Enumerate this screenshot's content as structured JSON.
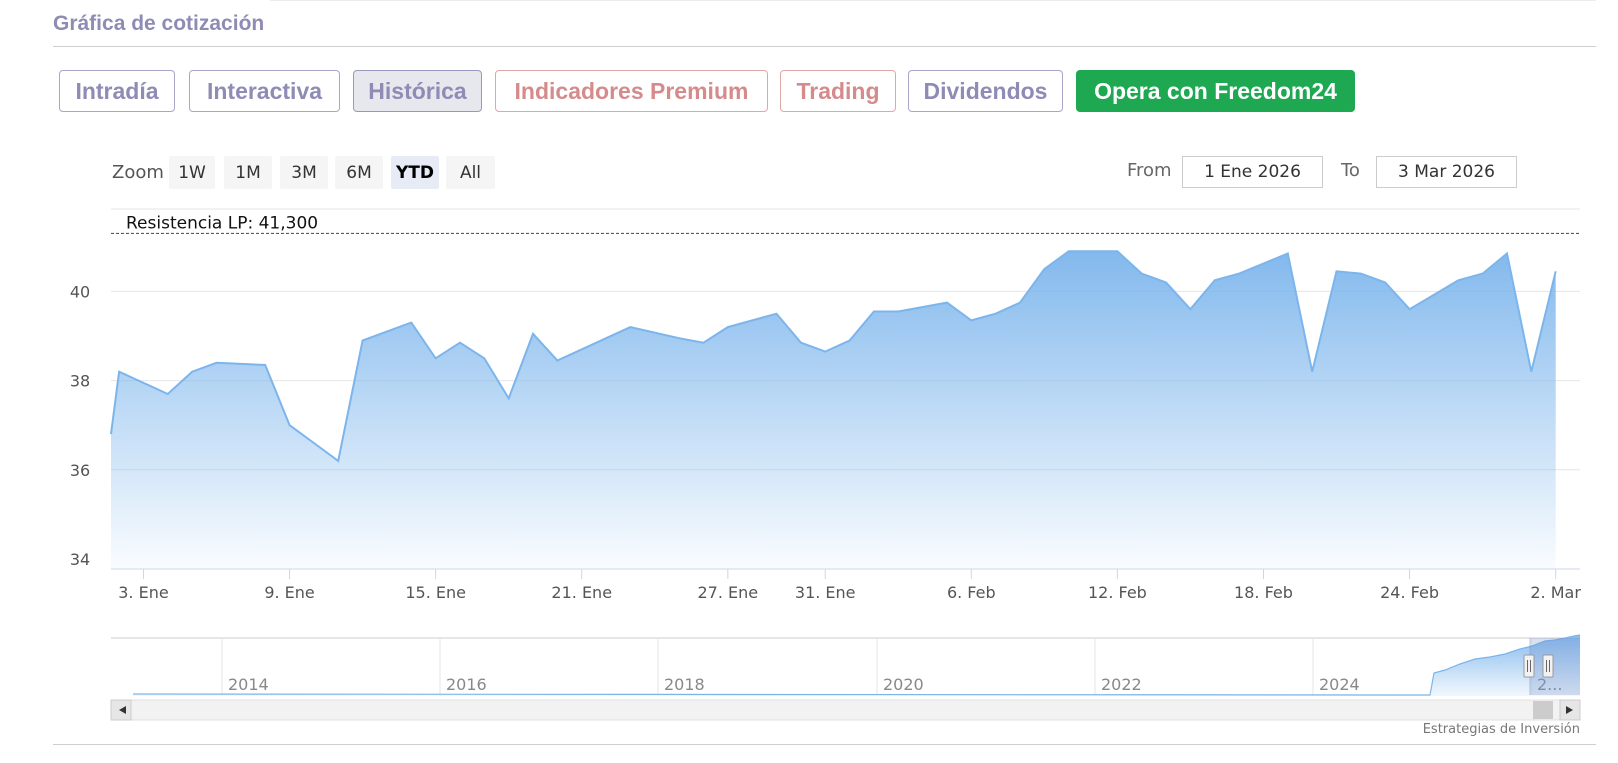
{
  "section_title": "Gráfica de cotización",
  "tabs": [
    {
      "label": "Intradía",
      "style": "normal"
    },
    {
      "label": "Interactiva",
      "style": "normal"
    },
    {
      "label": "Histórica",
      "style": "active"
    },
    {
      "label": "Indicadores Premium",
      "style": "premium"
    },
    {
      "label": "Trading",
      "style": "premium"
    },
    {
      "label": "Dividendos",
      "style": "normal"
    },
    {
      "label": "Opera con Freedom24",
      "style": "cta"
    }
  ],
  "zoom": {
    "label": "Zoom",
    "options": [
      "1W",
      "1M",
      "3M",
      "6M",
      "YTD",
      "All"
    ],
    "selected": "YTD"
  },
  "range": {
    "from_label": "From",
    "from_value": "1 Ene 2026",
    "to_label": "To",
    "to_value": "3 Mar 2026"
  },
  "credit": "Estrategias de Inversión",
  "colors": {
    "accent": "#8e8bb5",
    "premium": "#d58b8b",
    "cta": "#1da851",
    "series_line": "#7cb5ec",
    "resistance": "#2d7a2d"
  },
  "chart_data": {
    "type": "area",
    "title": "",
    "xlabel": "",
    "ylabel": "",
    "ylim": [
      34,
      41.3
    ],
    "yticks": [
      34,
      36,
      38,
      40
    ],
    "xticks": [
      {
        "label": "3. Ene",
        "x": "2026-01-03"
      },
      {
        "label": "9. Ene",
        "x": "2026-01-09"
      },
      {
        "label": "15. Ene",
        "x": "2026-01-15"
      },
      {
        "label": "21. Ene",
        "x": "2026-01-21"
      },
      {
        "label": "27. Ene",
        "x": "2026-01-27"
      },
      {
        "label": "31. Ene",
        "x": "2026-01-31"
      },
      {
        "label": "6. Feb",
        "x": "2026-02-06"
      },
      {
        "label": "12. Feb",
        "x": "2026-02-12"
      },
      {
        "label": "18. Feb",
        "x": "2026-02-18"
      },
      {
        "label": "24. Feb",
        "x": "2026-02-24"
      },
      {
        "label": "2. Mar",
        "x": "2026-03-02"
      }
    ],
    "xrange": [
      "2026-01-01 16:00",
      "2026-03-03"
    ],
    "annotation": {
      "label": "Resistencia LP: 41,300",
      "y": 41.3
    },
    "series": [
      {
        "x": [
          "2026-01-01 16:00",
          "2026-01-02",
          "2026-01-04",
          "2026-01-05",
          "2026-01-06",
          "2026-01-08",
          "2026-01-09",
          "2026-01-10",
          "2026-01-11",
          "2026-01-12",
          "2026-01-14",
          "2026-01-15",
          "2026-01-16",
          "2026-01-17",
          "2026-01-18",
          "2026-01-19",
          "2026-01-20",
          "2026-01-22",
          "2026-01-23",
          "2026-01-25",
          "2026-01-26",
          "2026-01-27",
          "2026-01-29",
          "2026-01-30",
          "2026-01-31",
          "2026-02-01",
          "2026-02-02",
          "2026-02-03",
          "2026-02-05",
          "2026-02-06",
          "2026-02-07",
          "2026-02-08",
          "2026-02-09",
          "2026-02-10",
          "2026-02-12",
          "2026-02-13",
          "2026-02-14",
          "2026-02-15",
          "2026-02-16",
          "2026-02-17",
          "2026-02-19",
          "2026-02-20",
          "2026-02-21",
          "2026-02-22",
          "2026-02-23",
          "2026-02-24",
          "2026-02-26",
          "2026-02-27",
          "2026-02-28",
          "2026-03-01",
          "2026-03-02"
        ],
        "values": [
          36.8,
          38.2,
          37.7,
          38.2,
          38.4,
          38.35,
          37.0,
          36.6,
          36.2,
          38.9,
          39.3,
          38.5,
          38.85,
          38.5,
          37.6,
          39.05,
          38.45,
          38.95,
          39.2,
          38.95,
          38.85,
          39.2,
          39.5,
          38.85,
          38.65,
          38.9,
          39.55,
          39.55,
          39.75,
          39.35,
          39.5,
          39.75,
          40.5,
          40.9,
          40.9,
          40.4,
          40.2,
          39.6,
          40.25,
          40.4,
          40.85,
          38.2,
          40.45,
          40.4,
          40.2,
          39.6,
          40.25,
          40.4,
          40.85,
          38.2,
          40.45
        ]
      }
    ],
    "navigator": {
      "years": [
        "2014",
        "2016",
        "2018",
        "2020",
        "2022",
        "2024",
        "2..."
      ]
    }
  }
}
